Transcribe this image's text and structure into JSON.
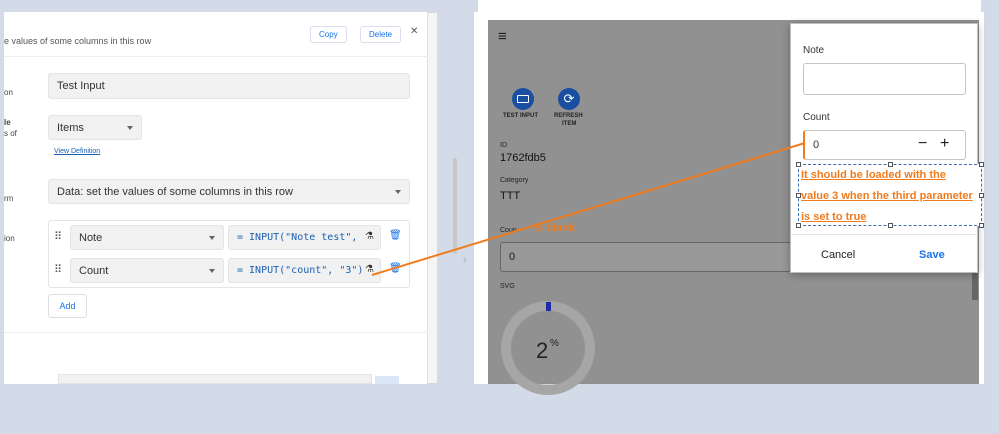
{
  "editor": {
    "subtitle": "e values of some columns in this row",
    "copy_label": "Copy",
    "delete_label": "Delete",
    "close_glyph": "✕",
    "row1_label": "on",
    "name_value": "Test Input",
    "row2_label_a": "le",
    "row2_label_b": "s of",
    "table_value": "Items",
    "view_definition": "View Definition",
    "row3_label": "rm",
    "action_value": "Data: set the values of some columns in this row",
    "row4_label": "ion",
    "columns": [
      {
        "column": "Note",
        "expression": "= INPUT(\"Note test\","
      },
      {
        "column": "Count",
        "expression": "= INPUT(\"count\", \"3\")"
      }
    ],
    "add_label": "Add",
    "drag_glyph": "⠿",
    "test_glyph": "⚗",
    "trash_glyph": "🗑"
  },
  "collapse_arrow": "›",
  "app": {
    "menu_glyph": "≡",
    "test_input_label": "TEST INPUT",
    "refresh_label_1": "REFRESH",
    "refresh_label_2": "ITEM",
    "id_label": "ID",
    "id_value": "1762fdb5",
    "category_label": "Category",
    "category_value": "TTT",
    "count_label": "Coun",
    "count_input_value": "0",
    "svg_label": "SVG",
    "gauge_value": "2",
    "gauge_unit": "%",
    "blank_annotation": "is blank"
  },
  "modal": {
    "note_label": "Note",
    "note_value": "",
    "count_label": "Count",
    "count_value": "0",
    "minus_glyph": "−",
    "plus_glyph": "+",
    "cancel_label": "Cancel",
    "save_label": "Save"
  },
  "annotation": {
    "text": "It should be loaded with the value 3 when the third parameter is set to true",
    "color": "#f07b1d"
  }
}
